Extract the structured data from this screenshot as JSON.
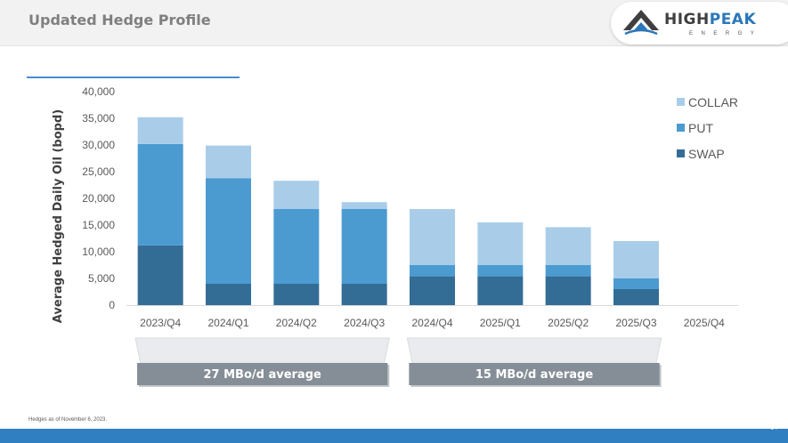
{
  "header": {
    "title": "Updated Hedge Profile"
  },
  "logo": {
    "word_part1": "HIGH",
    "word_part2": "PEAK",
    "subtitle": "ENERGY"
  },
  "footer": {
    "note": "Hedges as of November 6, 2023.",
    "page": "14"
  },
  "colors": {
    "swap": "#336d96",
    "put": "#4b9bd1",
    "collar": "#a9cde9",
    "avg_box": "#858e96",
    "avg_band": "#e9ebee",
    "accent": "#2f7fc1"
  },
  "chart_data": {
    "type": "bar",
    "stacked": true,
    "categories": [
      "2023/Q4",
      "2024/Q1",
      "2024/Q2",
      "2024/Q3",
      "2024/Q4",
      "2025/Q1",
      "2025/Q2",
      "2025/Q3",
      "2025/Q4"
    ],
    "series": [
      {
        "name": "SWAP",
        "values": [
          11200,
          4000,
          4000,
          4000,
          5400,
          5400,
          5400,
          3000,
          0
        ]
      },
      {
        "name": "PUT",
        "values": [
          19000,
          19800,
          14000,
          14000,
          2100,
          2100,
          2100,
          2000,
          0
        ]
      },
      {
        "name": "COLLAR",
        "values": [
          5000,
          6100,
          5300,
          1300,
          10500,
          8000,
          7100,
          7000,
          0
        ]
      }
    ],
    "ylabel": "Average Hedged Daily Oil (bopd)",
    "ylim": [
      0,
      40000
    ],
    "yticks": [
      0,
      5000,
      10000,
      15000,
      20000,
      25000,
      30000,
      35000,
      40000
    ],
    "ytick_labels": [
      "0",
      "5,000",
      "10,000",
      "15,000",
      "20,000",
      "25,000",
      "30,000",
      "35,000",
      "40,000"
    ],
    "legend_order": [
      "COLLAR",
      "PUT",
      "SWAP"
    ],
    "legend_position": "right",
    "grid": false,
    "annotations": [
      {
        "label": "27 MBo/d average",
        "start": 0,
        "end": 3
      },
      {
        "label": "15 MBo/d average",
        "start": 4,
        "end": 7
      }
    ]
  }
}
